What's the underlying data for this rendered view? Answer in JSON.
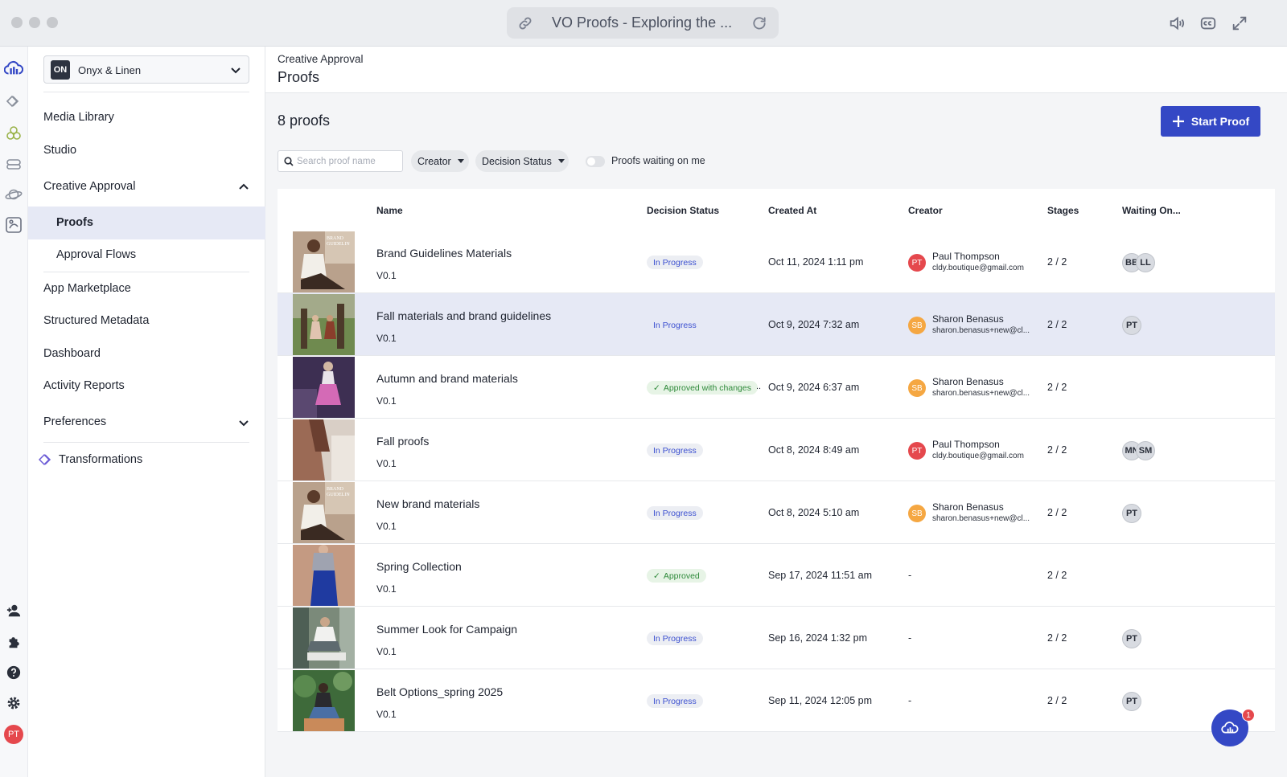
{
  "window": {
    "title": "VO Proofs - Exploring the ..."
  },
  "sidebar": {
    "org": {
      "initials": "ON",
      "name": "Onyx & Linen"
    },
    "items": [
      {
        "label": "Media Library"
      },
      {
        "label": "Studio"
      },
      {
        "label": "Creative Approval",
        "expanded": true
      },
      {
        "label": "Proofs",
        "active": true
      },
      {
        "label": "Approval Flows"
      },
      {
        "label": "App Marketplace"
      },
      {
        "label": "Structured Metadata"
      },
      {
        "label": "Dashboard"
      },
      {
        "label": "Activity Reports"
      },
      {
        "label": "Preferences",
        "expanded": false
      },
      {
        "label": "Transformations"
      }
    ],
    "user_initials": "PT"
  },
  "header": {
    "breadcrumb": "Creative Approval",
    "title": "Proofs"
  },
  "toolbar": {
    "count_label": "8 proofs",
    "start_button": "Start Proof",
    "search_placeholder": "Search proof name",
    "creator_filter": "Creator",
    "status_filter": "Decision Status",
    "waiting_toggle_label": "Proofs waiting on me",
    "waiting_toggle_on": false
  },
  "table": {
    "columns": [
      "Name",
      "Decision Status",
      "Created At",
      "Creator",
      "Stages",
      "Waiting On..."
    ],
    "rows": [
      {
        "name": "Brand Guidelines Materials",
        "version": "V0.1",
        "status": "In Progress",
        "created": "Oct 11, 2024 1:11 pm",
        "creator_initials": "PT",
        "creator_name": "Paul Thompson",
        "creator_email": "cldy.boutique@gmail.com",
        "stages": "2 / 2",
        "waiting": [
          "BB",
          "LL"
        ]
      },
      {
        "name": "Fall materials and brand guidelines",
        "version": "V0.1",
        "status": "In Progress",
        "created": "Oct 9, 2024 7:32 am",
        "creator_initials": "SB",
        "creator_name": "Sharon Benasus",
        "creator_email": "sharon.benasus+new@cl...",
        "stages": "2 / 2",
        "waiting": [
          "PT"
        ]
      },
      {
        "name": "Autumn and brand materials",
        "version": "V0.1",
        "status": "Approved with changes",
        "created": "Oct 9, 2024 6:37 am",
        "creator_initials": "SB",
        "creator_name": "Sharon Benasus",
        "creator_email": "sharon.benasus+new@cl...",
        "stages": "2 / 2",
        "waiting": []
      },
      {
        "name": "Fall proofs",
        "version": "V0.1",
        "status": "In Progress",
        "created": "Oct 8, 2024 8:49 am",
        "creator_initials": "PT",
        "creator_name": "Paul Thompson",
        "creator_email": "cldy.boutique@gmail.com",
        "stages": "2 / 2",
        "waiting": [
          "MN",
          "SM"
        ]
      },
      {
        "name": "New brand materials",
        "version": "V0.1",
        "status": "In Progress",
        "created": "Oct 8, 2024 5:10 am",
        "creator_initials": "SB",
        "creator_name": "Sharon Benasus",
        "creator_email": "sharon.benasus+new@cl...",
        "stages": "2 / 2",
        "waiting": [
          "PT"
        ]
      },
      {
        "name": "Spring Collection",
        "version": "V0.1",
        "status": "Approved",
        "created": "Sep 17, 2024 11:51 am",
        "creator_initials": "",
        "creator_name": "-",
        "creator_email": "",
        "stages": "2 / 2",
        "waiting": []
      },
      {
        "name": "Summer Look for Campaign",
        "version": "V0.1",
        "status": "In Progress",
        "created": "Sep 16, 2024 1:32 pm",
        "creator_initials": "",
        "creator_name": "-",
        "creator_email": "",
        "stages": "2 / 2",
        "waiting": [
          "PT"
        ]
      },
      {
        "name": "Belt Options_spring 2025",
        "version": "V0.1",
        "status": "In Progress",
        "created": "Sep 11, 2024 12:05 pm",
        "creator_initials": "",
        "creator_name": "-",
        "creator_email": "",
        "stages": "2 / 2",
        "waiting": [
          "PT"
        ]
      }
    ]
  },
  "chat": {
    "badge_count": "1"
  },
  "colors": {
    "accent": "#3448c5",
    "row_highlight": "#e6e9f5",
    "avatar_pt": "#e5484d",
    "avatar_sb": "#f5a742",
    "approved": "#2f8a3b"
  }
}
